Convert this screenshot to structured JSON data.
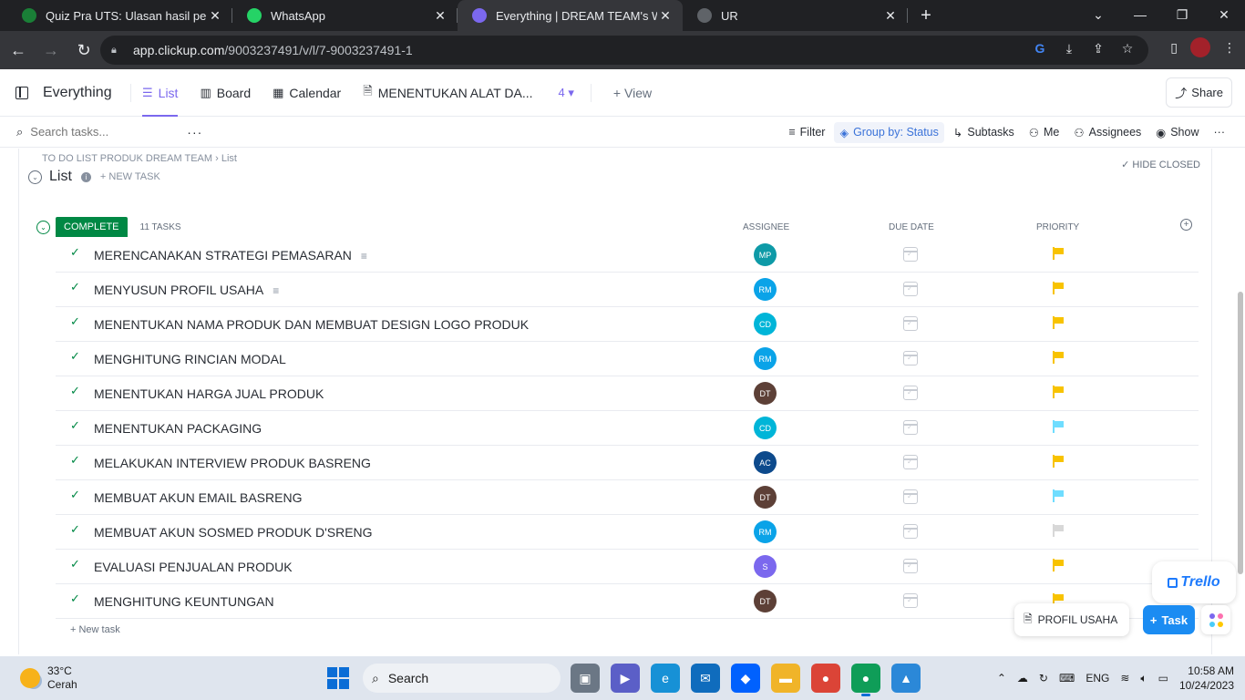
{
  "browser": {
    "tabs": [
      {
        "title": "Quiz Pra UTS: Ulasan hasil pengerjaan",
        "fav_color": "#1a7f37",
        "active": false
      },
      {
        "title": "WhatsApp",
        "fav_color": "#25d366",
        "active": false
      },
      {
        "title": "Everything | DREAM TEAM's Workspace",
        "fav_color": "#7b68ee",
        "active": true
      },
      {
        "title": "UR",
        "fav_color": "#5f6368",
        "active": false
      }
    ],
    "url_host": "app.clickup.com",
    "url_path": "/9003237491/v/l/7-9003237491-1"
  },
  "header": {
    "title": "Everything",
    "views": [
      {
        "label": "List",
        "icon": "list-icon",
        "active": true
      },
      {
        "label": "Board",
        "icon": "board-icon",
        "active": false
      },
      {
        "label": "Calendar",
        "icon": "calendar-icon",
        "active": false
      },
      {
        "label": "MENENTUKAN ALAT DA...",
        "icon": "doc-icon",
        "active": false
      }
    ],
    "more_count": "4",
    "add_view": "View",
    "share": "Share"
  },
  "toolbar": {
    "search_placeholder": "Search tasks...",
    "filter": "Filter",
    "group_by": "Group by: Status",
    "subtasks": "Subtasks",
    "me": "Me",
    "assignees": "Assignees",
    "show": "Show"
  },
  "list": {
    "breadcrumb_parent": "TO DO LIST PRODUK DREAM TEAM",
    "breadcrumb_current": "List",
    "title": "List",
    "new_task": "+ NEW TASK",
    "hide_closed": "HIDE CLOSED",
    "group": {
      "status": "COMPLETE",
      "status_color": "#008844",
      "count": "11 TASKS",
      "col_assignee": "ASSIGNEE",
      "col_due": "DUE DATE",
      "col_priority": "PRIORITY"
    },
    "tasks": [
      {
        "name": "MERENCANAKAN STRATEGI PEMASARAN",
        "desc": true,
        "assignee": "MP",
        "avatar_color": "#0e9aa7",
        "priority_color": "#f8c300"
      },
      {
        "name": "MENYUSUN PROFIL USAHA",
        "desc": true,
        "assignee": "RM",
        "avatar_color": "#0aa3e8",
        "priority_color": "#f8c300"
      },
      {
        "name": "MENENTUKAN NAMA PRODUK DAN MEMBUAT DESIGN LOGO PRODUK",
        "desc": false,
        "assignee": "CD",
        "avatar_color": "#00b5d8",
        "priority_color": "#f8c300"
      },
      {
        "name": "MENGHITUNG RINCIAN MODAL",
        "desc": false,
        "assignee": "RM",
        "avatar_color": "#0aa3e8",
        "priority_color": "#f8c300"
      },
      {
        "name": "MENENTUKAN HARGA JUAL PRODUK",
        "desc": false,
        "assignee": "DT",
        "avatar_color": "#5d4037",
        "priority_color": "#f8c300"
      },
      {
        "name": "MENENTUKAN PACKAGING",
        "desc": false,
        "assignee": "CD",
        "avatar_color": "#00b5d8",
        "priority_color": "#6fddff"
      },
      {
        "name": "MELAKUKAN INTERVIEW PRODUK BASRENG",
        "desc": false,
        "assignee": "AC",
        "avatar_color": "#0d4a8c",
        "priority_color": "#f8c300"
      },
      {
        "name": "MEMBUAT AKUN EMAIL BASRENG",
        "desc": false,
        "assignee": "DT",
        "avatar_color": "#5d4037",
        "priority_color": "#6fddff"
      },
      {
        "name": "MEMBUAT AKUN SOSMED PRODUK D'SRENG",
        "desc": false,
        "assignee": "RM",
        "avatar_color": "#0aa3e8",
        "priority_color": "#d8d8d8"
      },
      {
        "name": "EVALUASI PENJUALAN PRODUK",
        "desc": false,
        "assignee": "S",
        "avatar_color": "#7b68ee",
        "priority_color": "#f8c300"
      },
      {
        "name": "MENGHITUNG KEUNTUNGAN",
        "desc": false,
        "assignee": "DT",
        "avatar_color": "#5d4037",
        "priority_color": "#f8c300"
      }
    ],
    "add_task": "+ New task"
  },
  "floating": {
    "trello": "Trello",
    "doc_chip": "PROFIL USAHA",
    "task_button": "Task"
  },
  "taskbar": {
    "temp": "33°C",
    "weather": "Cerah",
    "search": "Search",
    "lang": "ENG",
    "time": "10:58 AM",
    "date": "10/24/2023"
  }
}
